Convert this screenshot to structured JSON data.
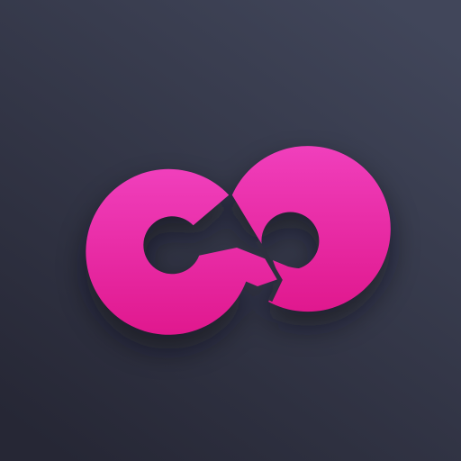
{
  "icon": {
    "name": "broken-infinity-icon",
    "colors": {
      "background_top": "#41465a",
      "background_bottom": "#262735",
      "logo_top": "#f03fbc",
      "logo_bottom": "#e0188e",
      "shadow": "#0b0c14"
    }
  }
}
